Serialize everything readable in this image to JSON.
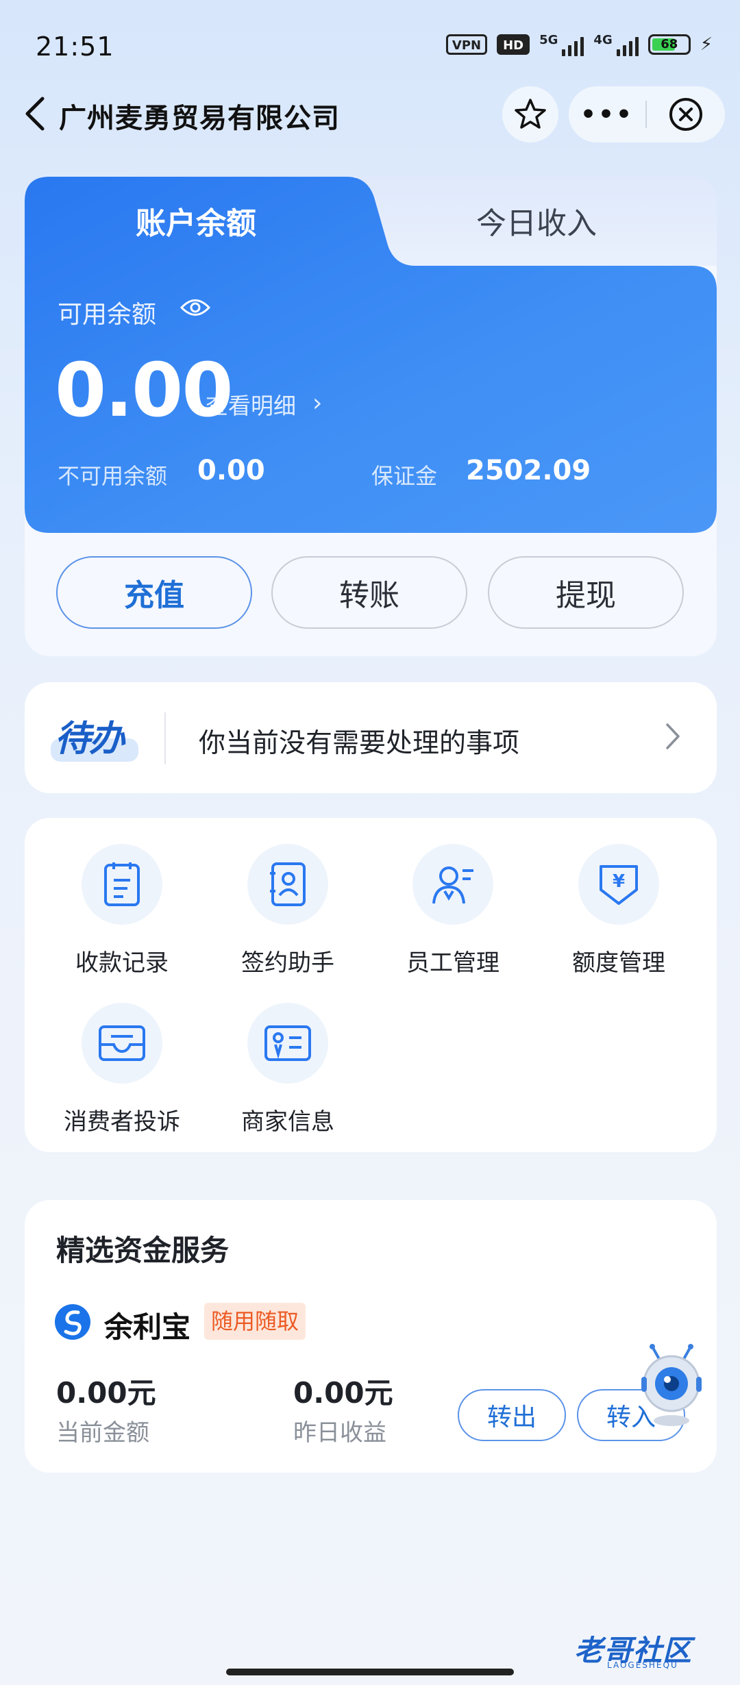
{
  "status_bar": {
    "time": "21:51",
    "vpn": "VPN",
    "hd": "HD",
    "net1": "5G",
    "net2": "4G",
    "battery": "68"
  },
  "header": {
    "title": "广州麦勇贸易有限公司",
    "more": "•••",
    "back_icon": "chevron-left-icon",
    "star_icon": "star-icon",
    "close_icon": "close-circle-icon"
  },
  "balance": {
    "tabs": [
      "账户余额",
      "今日收入"
    ],
    "available_label": "可用余额",
    "available_amount": "0.00",
    "detail_link": "查看明细",
    "unavailable_label": "不可用余额",
    "unavailable_amount": "0.00",
    "deposit_label": "保证金",
    "deposit_amount": "2502.09",
    "actions": [
      "充值",
      "转账",
      "提现"
    ],
    "accent": "#2e7ef3"
  },
  "todo": {
    "logo": "待办",
    "message": "你当前没有需要处理的事项"
  },
  "services": [
    {
      "label": "收款记录",
      "icon": "receipt-icon"
    },
    {
      "label": "签约助手",
      "icon": "contract-book-icon"
    },
    {
      "label": "员工管理",
      "icon": "staff-icon"
    },
    {
      "label": "额度管理",
      "icon": "yen-shield-icon"
    },
    {
      "label": "消费者投诉",
      "icon": "mail-tray-icon"
    },
    {
      "label": "商家信息",
      "icon": "id-card-icon"
    }
  ],
  "fund": {
    "title": "精选资金服务",
    "product": "余利宝",
    "tag": "随用随取",
    "current_amount": "0.00元",
    "current_label": "当前金额",
    "yesterday_amount": "0.00元",
    "yesterday_label": "昨日收益",
    "out_button": "转出",
    "in_button": "转入"
  },
  "watermark": {
    "text": "老哥社区",
    "sub": "LAOGESHEQU"
  }
}
